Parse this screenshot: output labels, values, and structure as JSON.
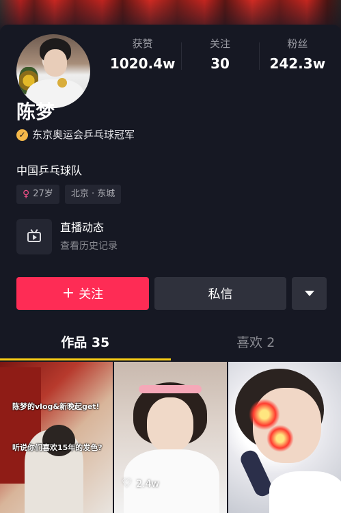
{
  "profile": {
    "stats": [
      {
        "label": "获赞",
        "value": "1020.4w"
      },
      {
        "label": "关注",
        "value": "30"
      },
      {
        "label": "粉丝",
        "value": "242.3w"
      }
    ],
    "name": "陈梦",
    "verification": "东京奥运会乒乓球冠军",
    "bio": "中国乒乓球队",
    "tags": {
      "age": "27岁",
      "location": "北京 · 东城"
    },
    "live": {
      "title": "直播动态",
      "subtitle": "查看历史记录"
    }
  },
  "actions": {
    "follow_label": "关注",
    "message_label": "私信"
  },
  "tabs": [
    {
      "label": "作品 35",
      "active": true
    },
    {
      "label": "喜欢 2",
      "active": false
    }
  ],
  "videos": [
    {
      "caption_top": "陈梦的vlog&新晚起get!",
      "caption_bottom": "听说你们喜欢15年的发色?"
    },
    {
      "likes": "2.4w"
    },
    {}
  ],
  "colors": {
    "background": "#161823",
    "accent_red": "#fe2c55",
    "tab_indicator": "#face15",
    "verify_badge": "#f4b84a"
  },
  "icons": [
    "verified-icon",
    "female-icon",
    "live-tv-icon",
    "plus-icon",
    "dropdown-caret-icon",
    "heart-icon"
  ]
}
